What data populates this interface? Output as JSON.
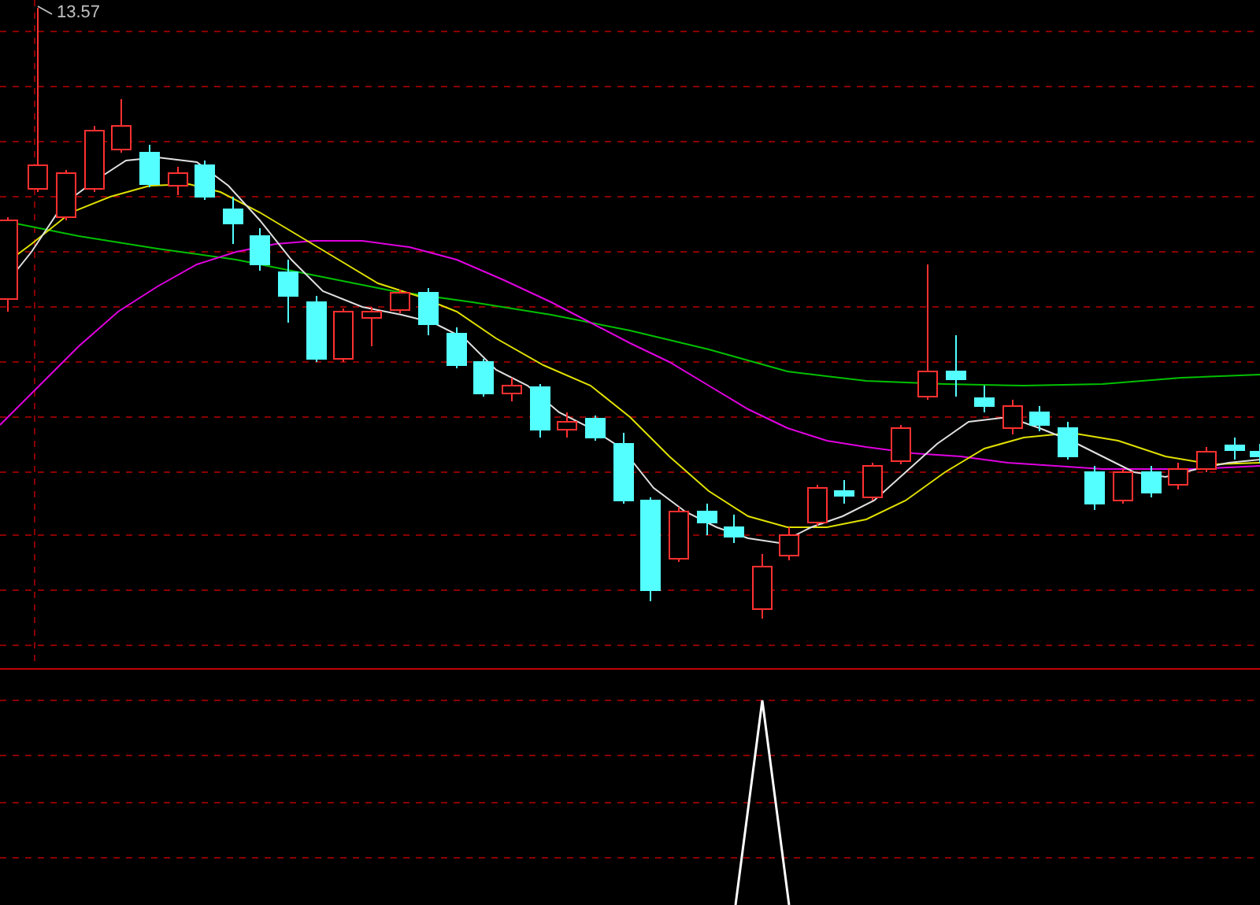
{
  "price_chart": {
    "high_label": "13.57"
  }
}
